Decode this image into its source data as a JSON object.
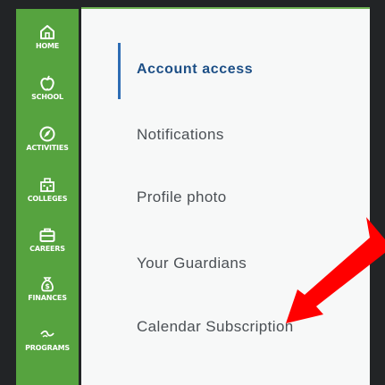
{
  "nav": {
    "items": [
      {
        "label": "HOME",
        "icon": "home-icon"
      },
      {
        "label": "SCHOOL",
        "icon": "apple-icon"
      },
      {
        "label": "ACTIVITIES",
        "icon": "compass-icon"
      },
      {
        "label": "COLLEGES",
        "icon": "building-icon"
      },
      {
        "label": "CAREERS",
        "icon": "briefcase-icon"
      },
      {
        "label": "FINANCES",
        "icon": "money-bag-icon"
      },
      {
        "label": "PROGRAMS",
        "icon": "programs-icon"
      }
    ],
    "accent": "#56a33f"
  },
  "settings_menu": {
    "items": [
      {
        "label": "Account access",
        "active": true
      },
      {
        "label": "Notifications",
        "active": false
      },
      {
        "label": "Profile photo",
        "active": false
      },
      {
        "label": "Your Guardians",
        "active": false
      },
      {
        "label": "Calendar Subscription",
        "active": false
      }
    ],
    "active_color": "#1d4f86"
  },
  "annotation": {
    "arrow_color": "#ff0000",
    "arrow_icon": "red-arrow-icon"
  }
}
